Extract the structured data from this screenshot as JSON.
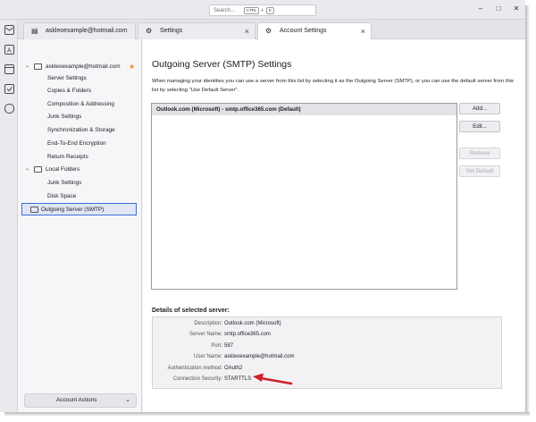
{
  "search": {
    "placeholder": "Search...",
    "kbd_ctrl": "CTRL",
    "kbd_k": "K"
  },
  "tabs": [
    {
      "label": "askleoexample@hotmail.com",
      "icon": "account-icon"
    },
    {
      "label": "Settings",
      "icon": "gear-icon"
    },
    {
      "label": "Account Settings",
      "icon": "account-settings-icon"
    }
  ],
  "sidebar": {
    "account": "askleoexample@hotmail.com",
    "account_items": [
      "Server Settings",
      "Copies & Folders",
      "Composition & Addressing",
      "Junk Settings",
      "Synchronization & Storage",
      "End-To-End Encryption",
      "Return Receipts"
    ],
    "local_folders": "Local Folders",
    "local_items": [
      "Junk Settings",
      "Disk Space"
    ],
    "smtp": "Outgoing Server (SMTP)",
    "account_actions": "Account Actions"
  },
  "main": {
    "title": "Outgoing Server (SMTP) Settings",
    "description": "When managing your identities you can use a server from this list by selecting it as the Outgoing Server (SMTP), or you can use the default server from this list by selecting \"Use Default Server\".",
    "servers": [
      "Outlook.com (Microsoft) - smtp.office365.com (Default)"
    ],
    "buttons": {
      "add": "Add...",
      "edit": "Edit...",
      "remove": "Remove",
      "set_default": "Set Default"
    },
    "details_title": "Details of selected server:",
    "details": [
      {
        "label": "Description:",
        "value": "Outlook.com (Microsoft)"
      },
      {
        "label": "Server Name:",
        "value": "smtp.office365.com"
      },
      {
        "label": "Port:",
        "value": "587"
      },
      {
        "label": "User Name:",
        "value": "askleoexample@hotmail.com"
      },
      {
        "label": "Authentication method:",
        "value": "OAuth2"
      },
      {
        "label": "Connection Security:",
        "value": "STARTTLS"
      }
    ]
  },
  "colors": {
    "accent": "#3a6fd8",
    "arrow": "#d0202a",
    "star": "#f08a24"
  }
}
